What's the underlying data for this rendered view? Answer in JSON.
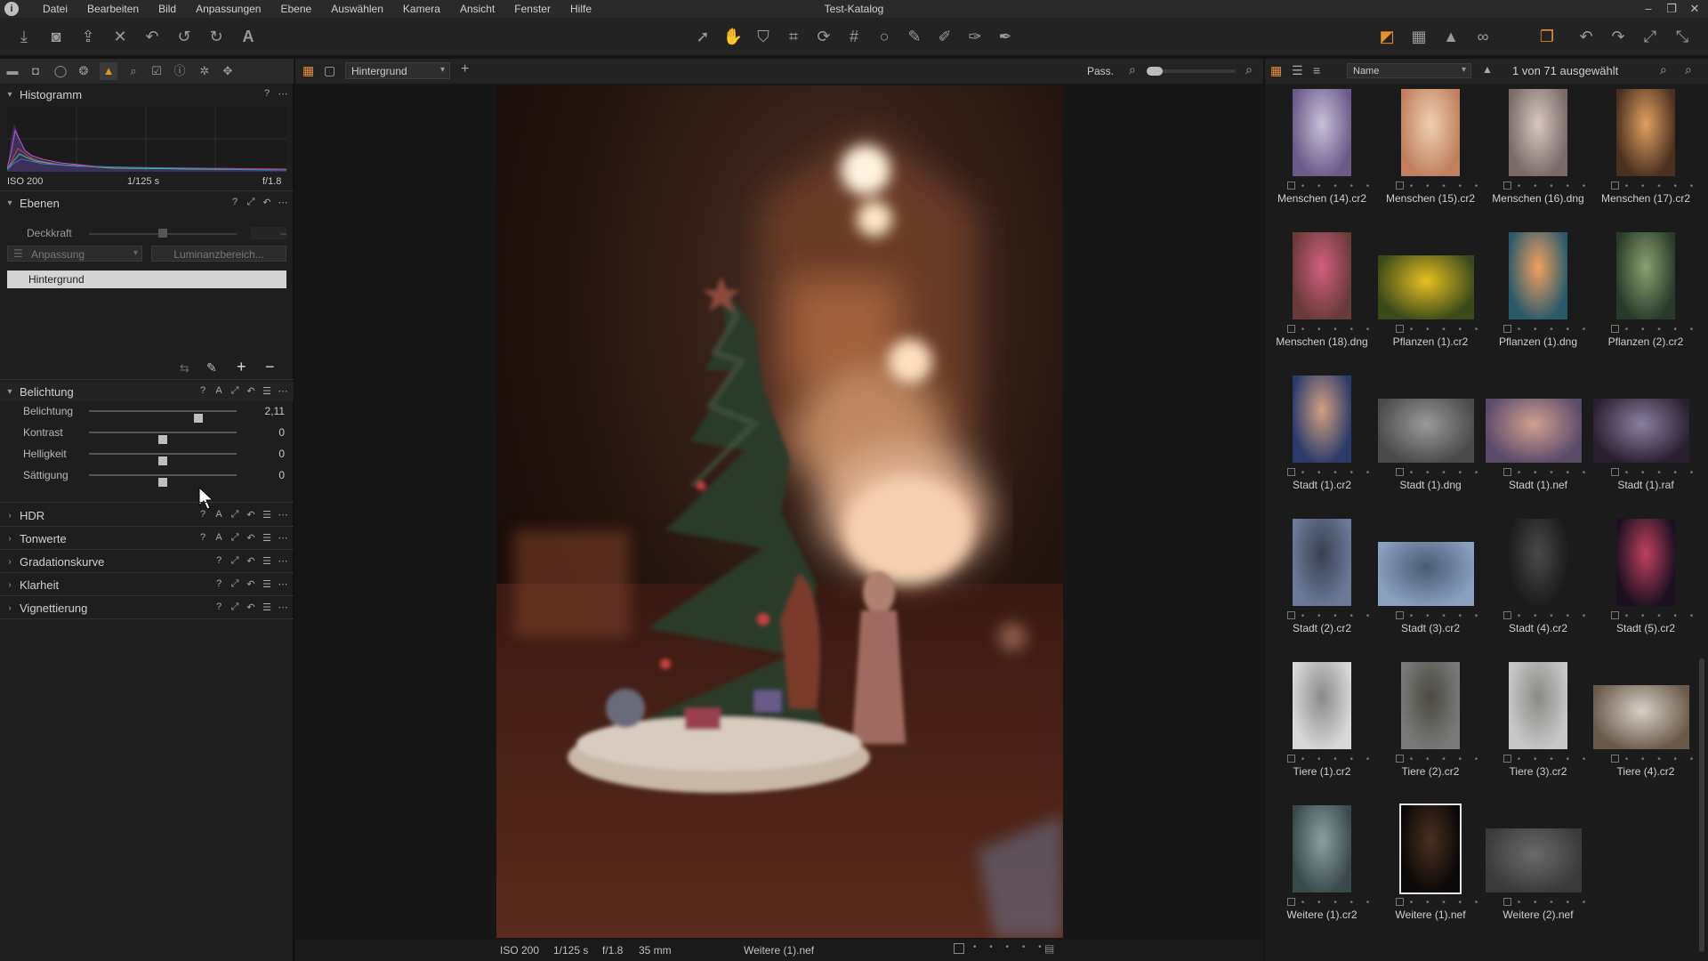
{
  "window": {
    "title": "Test-Katalog",
    "logo_letter": "i"
  },
  "menu": [
    "Datei",
    "Bearbeiten",
    "Bild",
    "Anpassungen",
    "Ebene",
    "Auswählen",
    "Kamera",
    "Ansicht",
    "Fenster",
    "Hilfe"
  ],
  "window_controls": {
    "minimize": "–",
    "restore": "❐",
    "close": "✕"
  },
  "histogram": {
    "title": "Histogramm",
    "iso": "ISO 200",
    "shutter": "1/125 s",
    "aperture": "f/1.8"
  },
  "layers": {
    "title": "Ebenen",
    "opacity_label": "Deckkraft",
    "opacity_value": "–",
    "adjust_label": "Anpassung",
    "luminance_label": "Luminanzbereich...",
    "layer_name": "Hintergrund"
  },
  "exposure": {
    "title": "Belichtung",
    "sliders": [
      {
        "label": "Belichtung",
        "value": "2,11",
        "position": 0.74
      },
      {
        "label": "Kontrast",
        "value": "0",
        "position": 0.5
      },
      {
        "label": "Helligkeit",
        "value": "0",
        "position": 0.5
      },
      {
        "label": "Sättigung",
        "value": "0",
        "position": 0.5
      }
    ]
  },
  "collapsed_sections": [
    "HDR",
    "Tonwerte",
    "Gradationskurve",
    "Klarheit",
    "Vignettierung"
  ],
  "viewer": {
    "layer_select": "Hintergrund",
    "fit_label": "Pass.",
    "footer_iso": "ISO 200",
    "footer_shutter": "1/125 s",
    "footer_aperture": "f/1.8",
    "footer_focal": "35 mm",
    "footer_file": "Weitere (1).nef"
  },
  "browser": {
    "sort_select": "Name",
    "selection_count": "1 von 71 ausgewählt",
    "rating_dots": "• • • • •",
    "thumbs": [
      {
        "name": "Menschen (14).cr2",
        "orient": "portrait"
      },
      {
        "name": "Menschen (15).cr2",
        "orient": "portrait"
      },
      {
        "name": "Menschen (16).dng",
        "orient": "portrait"
      },
      {
        "name": "Menschen (17).cr2",
        "orient": "portrait"
      },
      {
        "name": "Menschen (18).dng",
        "orient": "portrait"
      },
      {
        "name": "Pflanzen (1).cr2",
        "orient": "landscape"
      },
      {
        "name": "Pflanzen (1).dng",
        "orient": "portrait"
      },
      {
        "name": "Pflanzen (2).cr2",
        "orient": "portrait"
      },
      {
        "name": "Stadt (1).cr2",
        "orient": "portrait"
      },
      {
        "name": "Stadt (1).dng",
        "orient": "landscape"
      },
      {
        "name": "Stadt (1).nef",
        "orient": "landscape"
      },
      {
        "name": "Stadt (1).raf",
        "orient": "landscape"
      },
      {
        "name": "Stadt (2).cr2",
        "orient": "portrait"
      },
      {
        "name": "Stadt (3).cr2",
        "orient": "landscape"
      },
      {
        "name": "Stadt (4).cr2",
        "orient": "portrait"
      },
      {
        "name": "Stadt (5).cr2",
        "orient": "portrait"
      },
      {
        "name": "Tiere (1).cr2",
        "orient": "portrait"
      },
      {
        "name": "Tiere (2).cr2",
        "orient": "portrait"
      },
      {
        "name": "Tiere (3).cr2",
        "orient": "portrait"
      },
      {
        "name": "Tiere (4).cr2",
        "orient": "landscape"
      },
      {
        "name": "Weitere (1).cr2",
        "orient": "portrait"
      },
      {
        "name": "Weitere (1).nef",
        "orient": "portrait",
        "selected": true
      },
      {
        "name": "Weitere (2).nef",
        "orient": "landscape"
      }
    ]
  },
  "colors": {
    "accent": "#e8902a",
    "panel": "#1e1e1e",
    "background": "#141414"
  }
}
